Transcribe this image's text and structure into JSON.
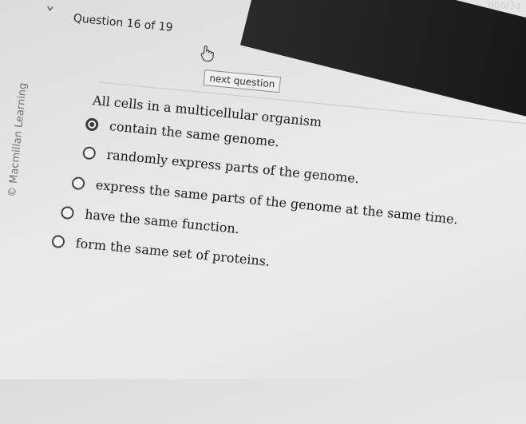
{
  "browser": {
    "url_fragment": "006/3a"
  },
  "header": {
    "question_title": "Question 16 of 19",
    "next_label": "next question"
  },
  "sidebar": {
    "brand": "© Macmillan Learning"
  },
  "question": {
    "prompt": "All cells in a multicellular organism",
    "options": [
      {
        "label": "contain the same genome.",
        "selected": true
      },
      {
        "label": "randomly express parts of the genome.",
        "selected": false
      },
      {
        "label": "express the same parts of the genome at the same time.",
        "selected": false
      },
      {
        "label": "have the same function.",
        "selected": false
      },
      {
        "label": "form the same set of proteins.",
        "selected": false
      }
    ]
  }
}
